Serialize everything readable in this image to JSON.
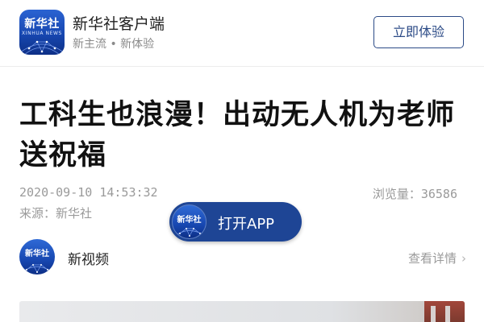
{
  "banner": {
    "logo_text": "新华社",
    "logo_subtext": "XINHUA NEWS",
    "app_name": "新华社客户端",
    "slogan": "新主流 • 新体验",
    "cta_label": "立即体验"
  },
  "article": {
    "title": "工科生也浪漫！出动无人机为老师送祝福",
    "datetime": "2020-09-10 14:53:32",
    "views_label": "浏览量：",
    "views_count": "36586",
    "source": "来源：新华社"
  },
  "open_app": {
    "logo_text": "新华社",
    "label": "打开APP"
  },
  "channel": {
    "avatar_text": "新华社",
    "name": "新视频",
    "link_label": "查看详情",
    "link_chevron": "›"
  },
  "colors": {
    "brand_blue": "#1e4595",
    "cta_border": "#2b4a86",
    "meta_gray": "#9a9a9a"
  },
  "icons": {
    "banner_logo": "xinhua-logo-icon",
    "pill_logo": "xinhua-logo-icon",
    "channel_avatar": "xinhua-avatar-icon",
    "link_chevron": "chevron-right-icon"
  }
}
